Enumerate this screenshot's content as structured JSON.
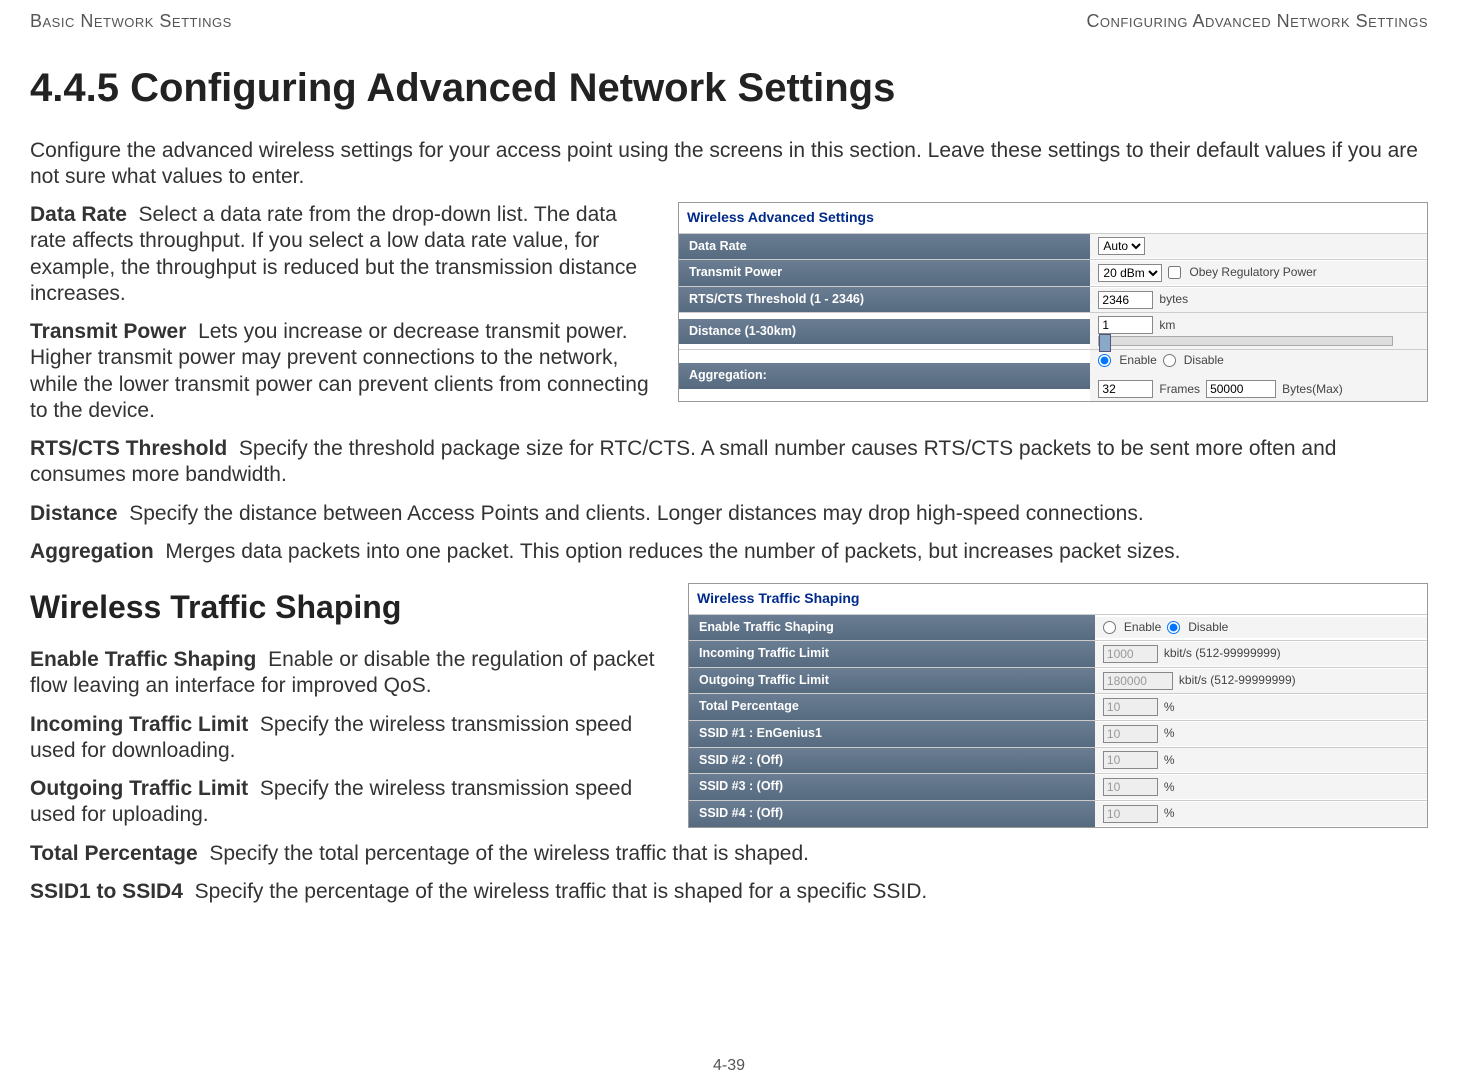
{
  "header": {
    "left": "Basic Network Settings",
    "right": "Configuring Advanced Network Settings"
  },
  "sectionNumber": "4.4.5",
  "title": "Configuring Advanced Network Settings",
  "intro": "Configure the advanced wireless settings for your access point using the screens in this section. Leave these settings to their default values if you are not sure what values to enter.",
  "terms1": [
    {
      "name": "Data Rate",
      "desc": "Select a data rate from the drop-down list. The data rate affects throughput. If you select a low data rate value, for example, the throughput is reduced but the transmission distance increases."
    },
    {
      "name": "Transmit Power",
      "desc": "Lets you increase or decrease transmit power. Higher transmit power may prevent connections to the network, while the lower transmit power can prevent clients from connecting to the device."
    },
    {
      "name": "RTS/CTS Threshold",
      "desc": "Specify the threshold package size for RTC/CTS. A small number causes RTS/CTS packets to be sent more often and consumes more bandwidth."
    },
    {
      "name": "Distance",
      "desc": "Specify the distance between Access Points and clients. Longer distances may drop high-speed connections."
    },
    {
      "name": "Aggregation",
      "desc": "Merges data packets into one packet. This option reduces the number of packets, but increases packet sizes."
    }
  ],
  "subheading": "Wireless Traffic Shaping",
  "terms2": [
    {
      "name": "Enable Traffic Shaping",
      "desc": "Enable or disable the regulation of packet flow leaving an interface for improved QoS."
    },
    {
      "name": "Incoming Traffic Limit",
      "desc": "Specify the wireless transmission speed used for downloading."
    },
    {
      "name": "Outgoing Traffic Limit",
      "desc": "Specify the wireless transmission speed used for uploading."
    },
    {
      "name": "Total Percentage",
      "desc": "Specify the total percentage of the wireless traffic that is shaped."
    },
    {
      "name": "SSID1 to SSID4",
      "desc": "Specify the percentage of the wireless traffic that is shaped for a specific SSID."
    }
  ],
  "figure1": {
    "title": "Wireless Advanced Settings",
    "rows": {
      "dataRate": {
        "label": "Data Rate",
        "value": "Auto"
      },
      "transmitPower": {
        "label": "Transmit Power",
        "value": "20 dBm",
        "obeyLabel": "Obey Regulatory Power",
        "obeyChecked": false
      },
      "rts": {
        "label": "RTS/CTS Threshold (1 - 2346)",
        "value": "2346",
        "unit": "bytes"
      },
      "distance": {
        "label": "Distance (1-30km)",
        "value": "1",
        "unit": "km"
      },
      "aggregation": {
        "label": "Aggregation:",
        "enableLabel": "Enable",
        "disableLabel": "Disable",
        "frames": "32",
        "framesUnit": "Frames",
        "bytes": "50000",
        "bytesUnit": "Bytes(Max)"
      }
    }
  },
  "figure2": {
    "title": "Wireless Traffic Shaping",
    "rows": {
      "ets": {
        "label": "Enable Traffic Shaping",
        "enableLabel": "Enable",
        "disableLabel": "Disable"
      },
      "in": {
        "label": "Incoming Traffic Limit",
        "value": "1000",
        "unit": "kbit/s (512-99999999)"
      },
      "out": {
        "label": "Outgoing Traffic Limit",
        "value": "180000",
        "unit": "kbit/s (512-99999999)"
      },
      "total": {
        "label": "Total Percentage",
        "value": "10",
        "unit": "%"
      },
      "ssid1": {
        "label": "SSID #1 : EnGenius1",
        "value": "10",
        "unit": "%"
      },
      "ssid2": {
        "label": "SSID #2 : (Off)",
        "value": "10",
        "unit": "%"
      },
      "ssid3": {
        "label": "SSID #3 : (Off)",
        "value": "10",
        "unit": "%"
      },
      "ssid4": {
        "label": "SSID #4 : (Off)",
        "value": "10",
        "unit": "%"
      }
    }
  },
  "pageNumber": "4-39"
}
